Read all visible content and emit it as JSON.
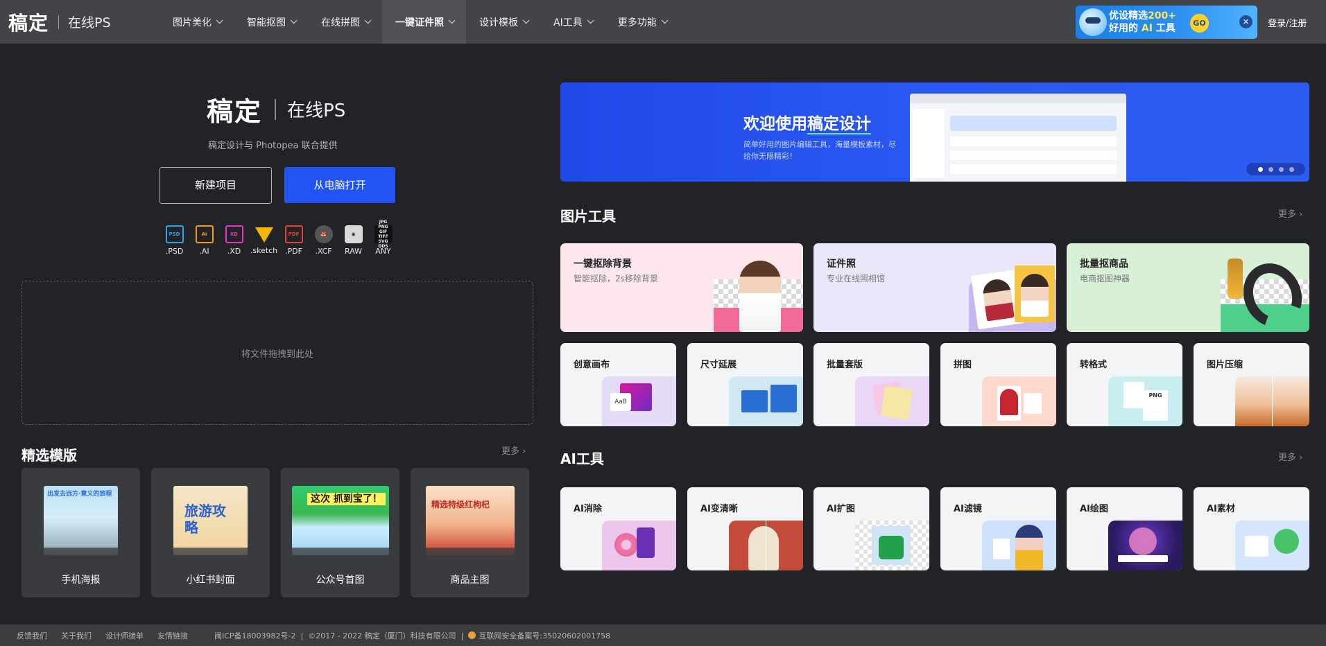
{
  "header": {
    "brand": "稿定",
    "sub": "在线PS",
    "nav": [
      {
        "label": "图片美化",
        "active": false
      },
      {
        "label": "智能抠图",
        "active": false
      },
      {
        "label": "在线拼图",
        "active": false
      },
      {
        "label": "一键证件照",
        "active": true
      },
      {
        "label": "设计模板",
        "active": false
      },
      {
        "label": "AI工具",
        "active": false
      },
      {
        "label": "更多功能",
        "active": false
      }
    ],
    "promo": {
      "line1_a": "优设精选",
      "line1_b": "200+",
      "line2_a": "好用的",
      "line2_b": "AI",
      "line2_c": "工具",
      "go": "GO",
      "close": "×"
    },
    "login": "登录/注册"
  },
  "hero": {
    "brand": "稿定",
    "sub": "在线PS",
    "caption": "稿定设计与 Photopea 联合提供",
    "new_project": "新建项目",
    "open_local": "从电脑打开",
    "formats": [
      {
        "icon": "psd-file-icon",
        "glyph": "PSD",
        "label": ".PSD"
      },
      {
        "icon": "ai-file-icon",
        "glyph": "Ai",
        "label": ".AI"
      },
      {
        "icon": "xd-file-icon",
        "glyph": "XD",
        "label": ".XD"
      },
      {
        "icon": "sketch-file-icon",
        "glyph": "",
        "label": ".sketch"
      },
      {
        "icon": "pdf-file-icon",
        "glyph": "PDF",
        "label": ".PDF"
      },
      {
        "icon": "xcf-file-icon",
        "glyph": "",
        "label": ".XCF"
      },
      {
        "icon": "raw-camera-icon",
        "glyph": "",
        "label": "RAW"
      },
      {
        "icon": "any-file-icon",
        "glyph": "JPG PNG GIF TIFF SVG DDS",
        "label": "ANY"
      }
    ],
    "dropzone": "将文件拖拽到此处"
  },
  "templates": {
    "title": "精选模版",
    "more": "更多 ›",
    "items": [
      {
        "label": "手机海报",
        "thumb_text": "出发去远方·意义的旅程"
      },
      {
        "label": "小红书封面",
        "thumb_text": "旅游攻略"
      },
      {
        "label": "公众号首图",
        "thumb_text": "这次 抓到宝了！"
      },
      {
        "label": "商品主图",
        "thumb_text": "精选特级红枸杞"
      }
    ]
  },
  "banner": {
    "title_a": "欢迎使用",
    "title_b": "稿定设计",
    "desc": "简单好用的图片编辑工具，海量模板素材，尽给你无限精彩！",
    "slides": 4,
    "active_slide": 1
  },
  "image_tools": {
    "title": "图片工具",
    "more": "更多 ›",
    "featured": [
      {
        "title": "一键抠除背景",
        "sub": "智能抠除，2s移除背景",
        "bg": "#fde7ec"
      },
      {
        "title": "证件照",
        "sub": "专业在线照相馆",
        "bg": "#ebe6f9"
      },
      {
        "title": "批量抠商品",
        "sub": "电商抠图神器",
        "bg": "#d8f0d6"
      }
    ],
    "small": [
      {
        "title": "创意画布"
      },
      {
        "title": "尺寸延展"
      },
      {
        "title": "批量套版"
      },
      {
        "title": "拼图"
      },
      {
        "title": "转格式"
      },
      {
        "title": "图片压缩"
      }
    ]
  },
  "ai_tools": {
    "title": "AI工具",
    "more": "更多 ›",
    "items": [
      {
        "title": "AI消除"
      },
      {
        "title": "AI变清晰"
      },
      {
        "title": "AI扩图"
      },
      {
        "title": "AI滤镜"
      },
      {
        "title": "AI绘图"
      },
      {
        "title": "AI素材"
      }
    ]
  },
  "footer": {
    "links": [
      "反馈我们",
      "关于我们",
      "设计师接单",
      "友情链接"
    ],
    "icp": "闽ICP备18003982号-2",
    "copyright": "©2017 - 2022 稿定（厦门）科技有限公司",
    "security": "互联网安全备案号:35020602001758"
  },
  "colors": {
    "bg": "#222326",
    "topbar": "#434447",
    "primary": "#2254f4",
    "card_light": "#f3f4f6"
  }
}
